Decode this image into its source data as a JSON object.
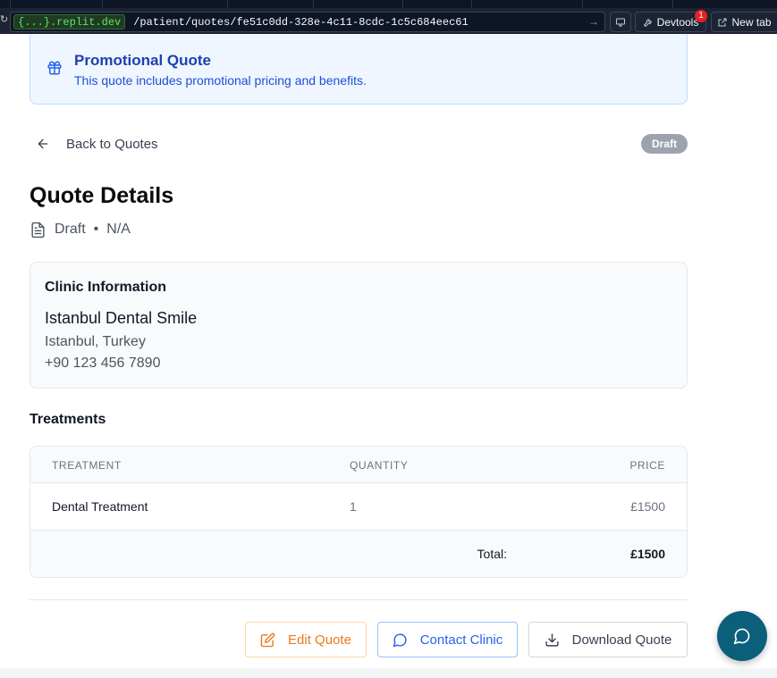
{
  "browser": {
    "host": "{...}.replit.dev",
    "path": "/patient/quotes/fe51c0dd-328e-4c11-8cdc-1c5c684eec61",
    "devtools_label": "Devtools",
    "devtools_badge": "1",
    "new_tab_label": "New tab"
  },
  "promo": {
    "title": "Promotional Quote",
    "subtitle": "This quote includes promotional pricing and benefits."
  },
  "nav": {
    "back_label": "Back to Quotes",
    "status": "Draft"
  },
  "header": {
    "title": "Quote Details",
    "status": "Draft",
    "separator": "•",
    "reference": "N/A"
  },
  "clinic": {
    "heading": "Clinic Information",
    "name": "Istanbul Dental Smile",
    "location": "Istanbul, Turkey",
    "phone": "+90 123 456 7890"
  },
  "treatments": {
    "heading": "Treatments",
    "columns": [
      "TREATMENT",
      "QUANTITY",
      "PRICE"
    ],
    "rows": [
      {
        "name": "Dental Treatment",
        "quantity": "1",
        "price": "£1500"
      }
    ],
    "total_label": "Total:",
    "total_value": "£1500"
  },
  "actions": {
    "edit": "Edit Quote",
    "contact": "Contact Clinic",
    "download": "Download Quote"
  },
  "colors": {
    "brand_fab": "#0b5f7a",
    "promo_title": "#1e40af",
    "edit_accent": "#ea7a18",
    "contact_accent": "#2563eb",
    "status_pill": "#9ca3af"
  }
}
